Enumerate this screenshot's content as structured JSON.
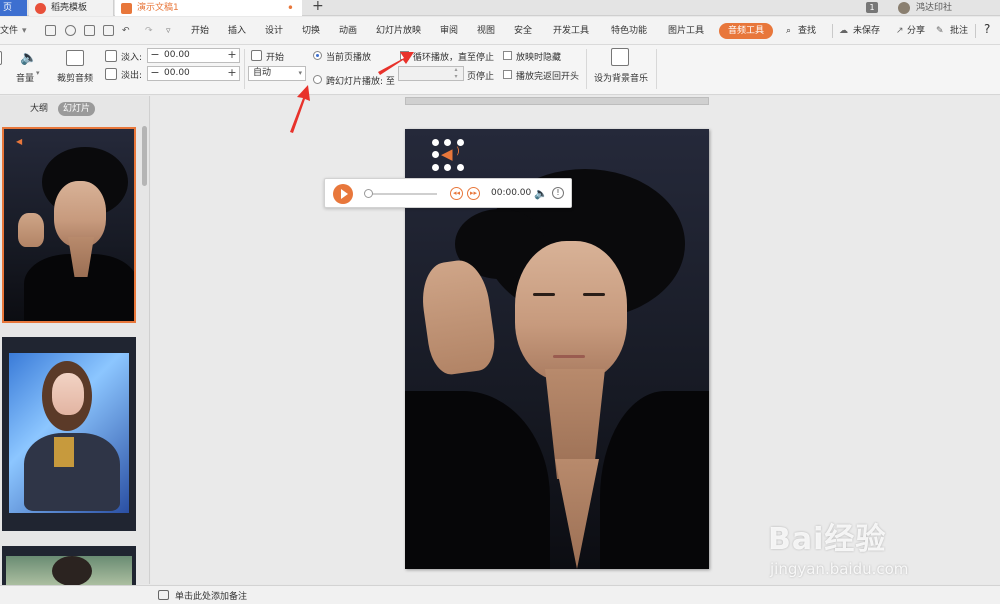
{
  "tabs": {
    "home": "页",
    "template": "稻壳模板",
    "document": "演示文稿1",
    "add": "+"
  },
  "titlebar_right": {
    "badge": "1",
    "user": "鸿达印社"
  },
  "menu": {
    "file": "文件",
    "items": [
      "开始",
      "插入",
      "设计",
      "切换",
      "动画",
      "幻灯片放映",
      "审阅",
      "视图",
      "安全",
      "开发工具",
      "特色功能",
      "图片工具",
      "音频工具"
    ],
    "active": "音频工具",
    "search": "查找",
    "unsaved": "未保存",
    "share": "分享",
    "comment": "批注",
    "help": "?"
  },
  "ribbon": {
    "volume": "音量",
    "trim": "裁剪音频",
    "fade_in_label": "淡入:",
    "fade_in_value": "00.00",
    "fade_out_label": "淡出:",
    "fade_out_value": "00.00",
    "start_label": "开始",
    "start_value": "自动",
    "radio_current": "当前页播放",
    "radio_cross": "跨幻灯片播放: 至",
    "page_stop": "页停止",
    "loop": "循环播放，直至停止",
    "hide_when_show": "放映时隐藏",
    "rewind": "播放完返回开头",
    "set_bg_music": "设为背景音乐",
    "colors": {
      "accent": "#e8773b",
      "annotation_arrow": "#e8322b"
    }
  },
  "left_panel": {
    "tab_outline": "大纲",
    "tab_slides": "幻灯片",
    "add_slide": "+"
  },
  "player": {
    "time": "00:00.00",
    "prev_icon": "rewind-icon",
    "next_icon": "fast-forward-icon",
    "info": "!"
  },
  "watermark": {
    "brand": "Bai经验",
    "url": "jingyan.baidu.com"
  },
  "notes": {
    "placeholder": "单击此处添加备注"
  }
}
